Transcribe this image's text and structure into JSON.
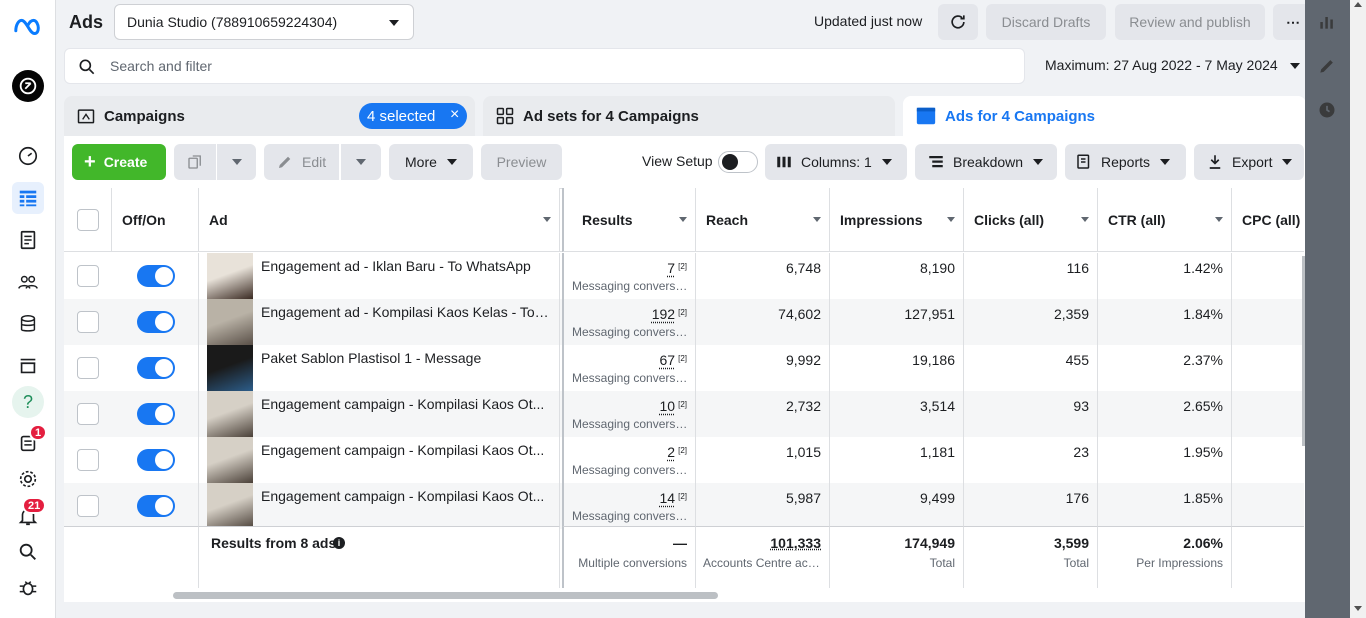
{
  "app": {
    "title": "Ads"
  },
  "account": {
    "selector_value": "Dunia Studio (788910659224304)"
  },
  "status": {
    "updated": "Updated just now"
  },
  "actions": {
    "discard": "Discard Drafts",
    "review": "Review and publish",
    "more_dots": "⋯"
  },
  "search": {
    "placeholder": "Search and filter"
  },
  "date_range": {
    "label": "Maximum: 27 Aug 2022 - 7 May 2024"
  },
  "tabs": {
    "campaigns": "Campaigns",
    "selected_chip": "4 selected",
    "ad_sets": "Ad sets for 4 Campaigns",
    "ads": "Ads for 4 Campaigns"
  },
  "toolbar": {
    "create": "Create",
    "edit": "Edit",
    "more": "More",
    "preview": "Preview",
    "view_setup": "View Setup",
    "columns": "Columns: 1",
    "breakdown": "Breakdown",
    "reports": "Reports",
    "export": "Export"
  },
  "columns": {
    "offon": "Off/On",
    "ad": "Ad",
    "results": "Results",
    "reach": "Reach",
    "impressions": "Impressions",
    "clicks": "Clicks (all)",
    "ctr": "CTR (all)",
    "cpc": "CPC (all)"
  },
  "rows": [
    {
      "name": "Engagement ad - Iklan Baru - To WhatsApp",
      "results": "7",
      "sup": "[2]",
      "results_sub": "Messaging conversations started",
      "reach": "6,748",
      "impressions": "8,190",
      "clicks": "116",
      "ctr": "1.42%",
      "on": true
    },
    {
      "name": "Engagement ad - Kompilasi Kaos Kelas - To WhatsApp",
      "results": "192",
      "sup": "[2]",
      "results_sub": "Messaging conversations started",
      "reach": "74,602",
      "impressions": "127,951",
      "clicks": "2,359",
      "ctr": "1.84%",
      "on": true
    },
    {
      "name": "Paket Sablon Plastisol 1 - Message",
      "results": "67",
      "sup": "[2]",
      "results_sub": "Messaging conversations started",
      "reach": "9,992",
      "impressions": "19,186",
      "clicks": "455",
      "ctr": "2.37%",
      "on": true
    },
    {
      "name": "Engagement campaign - Kompilasi Kaos Ot...",
      "results": "10",
      "sup": "[2]",
      "results_sub": "Messaging conversations started",
      "reach": "2,732",
      "impressions": "3,514",
      "clicks": "93",
      "ctr": "2.65%",
      "on": true
    },
    {
      "name": "Engagement campaign - Kompilasi Kaos Ot...",
      "results": "2",
      "sup": "[2]",
      "results_sub": "Messaging conversations started",
      "reach": "1,015",
      "impressions": "1,181",
      "clicks": "23",
      "ctr": "1.95%",
      "on": true
    },
    {
      "name": "Engagement campaign - Kompilasi Kaos Ot...",
      "results": "14",
      "sup": "[2]",
      "results_sub": "Messaging conversations started",
      "reach": "5,987",
      "impressions": "9,499",
      "clicks": "176",
      "ctr": "1.85%",
      "on": true
    }
  ],
  "footer": {
    "label": "Results from 8 ads",
    "results": "—",
    "results_sub": "Multiple conversions",
    "reach": "101,333",
    "reach_sub": "Accounts Centre accounts",
    "impressions": "174,949",
    "impressions_sub": "Total",
    "clicks": "3,599",
    "clicks_sub": "Total",
    "ctr": "2.06%",
    "ctr_sub": "Per Impressions"
  },
  "rail": {
    "help": "?",
    "notif_badge_1": "1",
    "notif_badge_21": "21"
  },
  "colors": {
    "accent": "#1877f2",
    "create_green": "#42b72a",
    "badge_red": "#e41e3f"
  }
}
